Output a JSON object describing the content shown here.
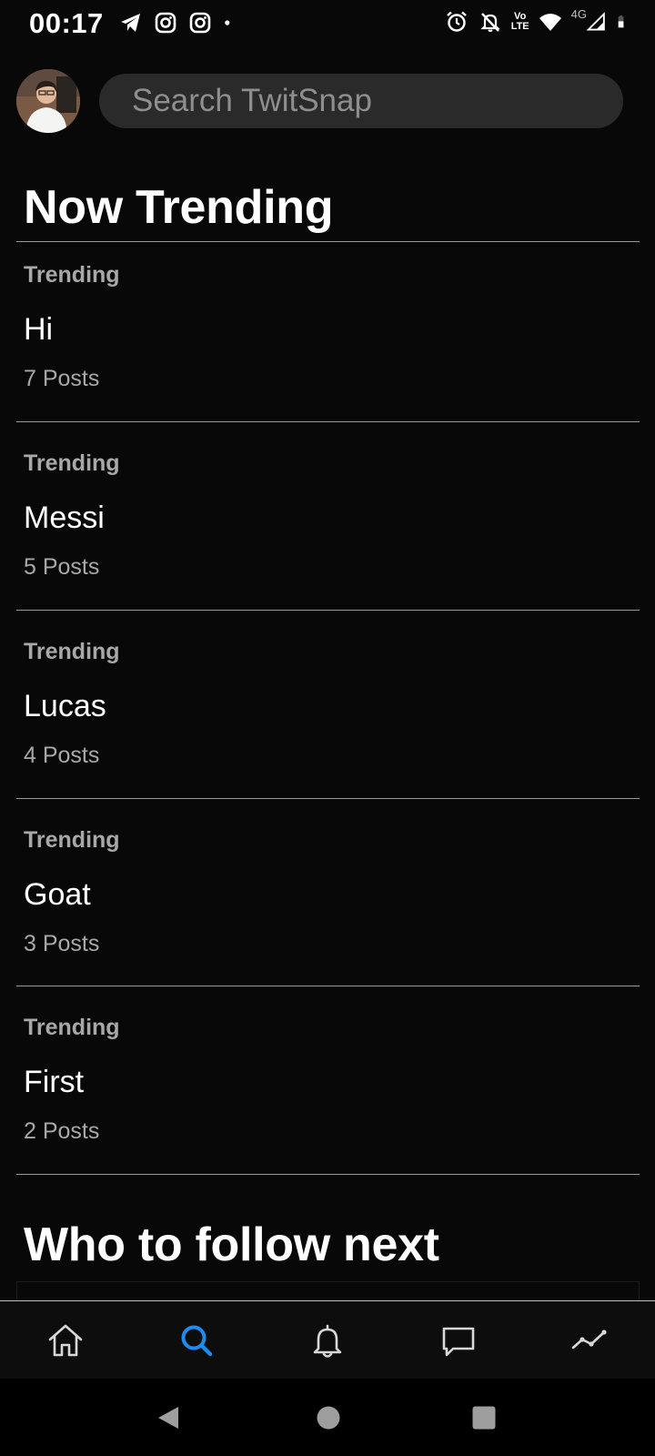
{
  "status_bar": {
    "time": "00:17",
    "network": "4G",
    "volte_top": "Vo",
    "volte_bottom": "LTE"
  },
  "header": {
    "search_placeholder": "Search TwitSnap"
  },
  "trending": {
    "title": "Now Trending",
    "items": [
      {
        "label": "Trending",
        "name": "Hi",
        "count": "7 Posts"
      },
      {
        "label": "Trending",
        "name": "Messi",
        "count": "5 Posts"
      },
      {
        "label": "Trending",
        "name": "Lucas",
        "count": "4 Posts"
      },
      {
        "label": "Trending",
        "name": "Goat",
        "count": "3 Posts"
      },
      {
        "label": "Trending",
        "name": "First",
        "count": "2 Posts"
      }
    ]
  },
  "follow": {
    "title": "Who to follow next"
  },
  "tab_bar": {
    "active_color": "#1d8cf0",
    "inactive_color": "#d8d8d8",
    "tabs": [
      {
        "icon": "home-icon"
      },
      {
        "icon": "search-icon"
      },
      {
        "icon": "bell-icon"
      },
      {
        "icon": "message-icon"
      },
      {
        "icon": "trending-icon"
      }
    ]
  }
}
